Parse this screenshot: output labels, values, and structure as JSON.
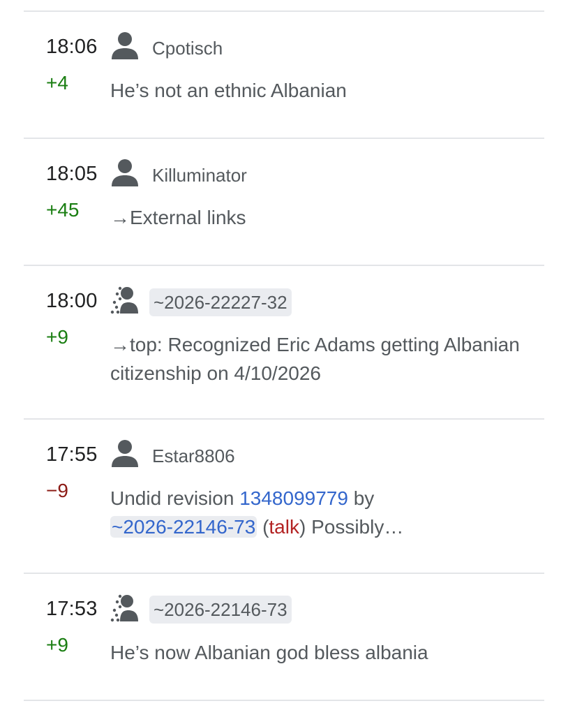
{
  "entries": [
    {
      "time": "18:06",
      "user": "Cpotisch",
      "user_type": "registered",
      "user_icon": "user-icon",
      "diff": "+4",
      "summary": "He’s not an ethnic Albanian"
    },
    {
      "time": "18:05",
      "user": "Killuminator",
      "user_type": "registered",
      "user_icon": "user-icon",
      "diff": "+45",
      "summary": "→External links"
    },
    {
      "time": "18:00",
      "user": "~2026-22227-32",
      "user_type": "temporary",
      "user_icon": "temporary-user-icon",
      "diff": "+9",
      "summary": "→top: Recognized Eric Adams getting Albanian citizenship on 4/10/2026"
    },
    {
      "time": "17:55",
      "user": "Estar8806",
      "user_type": "registered",
      "user_icon": "user-icon",
      "diff": "−9",
      "summary_parts": {
        "undid": "Undid revision ",
        "revision": "1348099779",
        "by": " by",
        "target_user": "~2026-22146-73",
        "open_paren": " (",
        "talk": "talk",
        "close_rest": ") Possibly…"
      }
    },
    {
      "time": "17:53",
      "user": "~2026-22146-73",
      "user_type": "temporary",
      "user_icon": "temporary-user-icon",
      "diff": "+9",
      "summary": "He’s now Albanian god bless albania"
    }
  ],
  "colors": {
    "positive": "#1a7e12",
    "negative": "#8c1b16",
    "link": "#3366cc",
    "red_link": "#b32424",
    "divider": "#e3e5e8"
  }
}
